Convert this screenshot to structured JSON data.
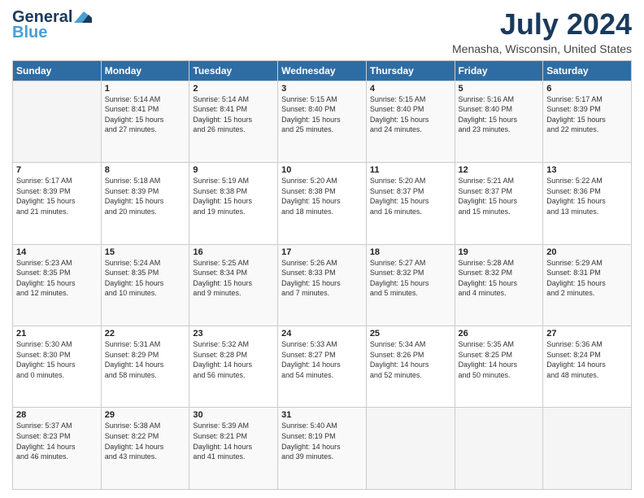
{
  "logo": {
    "line1": "General",
    "line2": "Blue"
  },
  "title": "July 2024",
  "location": "Menasha, Wisconsin, United States",
  "days_of_week": [
    "Sunday",
    "Monday",
    "Tuesday",
    "Wednesday",
    "Thursday",
    "Friday",
    "Saturday"
  ],
  "weeks": [
    [
      {
        "num": "",
        "info": ""
      },
      {
        "num": "1",
        "info": "Sunrise: 5:14 AM\nSunset: 8:41 PM\nDaylight: 15 hours\nand 27 minutes."
      },
      {
        "num": "2",
        "info": "Sunrise: 5:14 AM\nSunset: 8:41 PM\nDaylight: 15 hours\nand 26 minutes."
      },
      {
        "num": "3",
        "info": "Sunrise: 5:15 AM\nSunset: 8:40 PM\nDaylight: 15 hours\nand 25 minutes."
      },
      {
        "num": "4",
        "info": "Sunrise: 5:15 AM\nSunset: 8:40 PM\nDaylight: 15 hours\nand 24 minutes."
      },
      {
        "num": "5",
        "info": "Sunrise: 5:16 AM\nSunset: 8:40 PM\nDaylight: 15 hours\nand 23 minutes."
      },
      {
        "num": "6",
        "info": "Sunrise: 5:17 AM\nSunset: 8:39 PM\nDaylight: 15 hours\nand 22 minutes."
      }
    ],
    [
      {
        "num": "7",
        "info": "Sunrise: 5:17 AM\nSunset: 8:39 PM\nDaylight: 15 hours\nand 21 minutes."
      },
      {
        "num": "8",
        "info": "Sunrise: 5:18 AM\nSunset: 8:39 PM\nDaylight: 15 hours\nand 20 minutes."
      },
      {
        "num": "9",
        "info": "Sunrise: 5:19 AM\nSunset: 8:38 PM\nDaylight: 15 hours\nand 19 minutes."
      },
      {
        "num": "10",
        "info": "Sunrise: 5:20 AM\nSunset: 8:38 PM\nDaylight: 15 hours\nand 18 minutes."
      },
      {
        "num": "11",
        "info": "Sunrise: 5:20 AM\nSunset: 8:37 PM\nDaylight: 15 hours\nand 16 minutes."
      },
      {
        "num": "12",
        "info": "Sunrise: 5:21 AM\nSunset: 8:37 PM\nDaylight: 15 hours\nand 15 minutes."
      },
      {
        "num": "13",
        "info": "Sunrise: 5:22 AM\nSunset: 8:36 PM\nDaylight: 15 hours\nand 13 minutes."
      }
    ],
    [
      {
        "num": "14",
        "info": "Sunrise: 5:23 AM\nSunset: 8:35 PM\nDaylight: 15 hours\nand 12 minutes."
      },
      {
        "num": "15",
        "info": "Sunrise: 5:24 AM\nSunset: 8:35 PM\nDaylight: 15 hours\nand 10 minutes."
      },
      {
        "num": "16",
        "info": "Sunrise: 5:25 AM\nSunset: 8:34 PM\nDaylight: 15 hours\nand 9 minutes."
      },
      {
        "num": "17",
        "info": "Sunrise: 5:26 AM\nSunset: 8:33 PM\nDaylight: 15 hours\nand 7 minutes."
      },
      {
        "num": "18",
        "info": "Sunrise: 5:27 AM\nSunset: 8:32 PM\nDaylight: 15 hours\nand 5 minutes."
      },
      {
        "num": "19",
        "info": "Sunrise: 5:28 AM\nSunset: 8:32 PM\nDaylight: 15 hours\nand 4 minutes."
      },
      {
        "num": "20",
        "info": "Sunrise: 5:29 AM\nSunset: 8:31 PM\nDaylight: 15 hours\nand 2 minutes."
      }
    ],
    [
      {
        "num": "21",
        "info": "Sunrise: 5:30 AM\nSunset: 8:30 PM\nDaylight: 15 hours\nand 0 minutes."
      },
      {
        "num": "22",
        "info": "Sunrise: 5:31 AM\nSunset: 8:29 PM\nDaylight: 14 hours\nand 58 minutes."
      },
      {
        "num": "23",
        "info": "Sunrise: 5:32 AM\nSunset: 8:28 PM\nDaylight: 14 hours\nand 56 minutes."
      },
      {
        "num": "24",
        "info": "Sunrise: 5:33 AM\nSunset: 8:27 PM\nDaylight: 14 hours\nand 54 minutes."
      },
      {
        "num": "25",
        "info": "Sunrise: 5:34 AM\nSunset: 8:26 PM\nDaylight: 14 hours\nand 52 minutes."
      },
      {
        "num": "26",
        "info": "Sunrise: 5:35 AM\nSunset: 8:25 PM\nDaylight: 14 hours\nand 50 minutes."
      },
      {
        "num": "27",
        "info": "Sunrise: 5:36 AM\nSunset: 8:24 PM\nDaylight: 14 hours\nand 48 minutes."
      }
    ],
    [
      {
        "num": "28",
        "info": "Sunrise: 5:37 AM\nSunset: 8:23 PM\nDaylight: 14 hours\nand 46 minutes."
      },
      {
        "num": "29",
        "info": "Sunrise: 5:38 AM\nSunset: 8:22 PM\nDaylight: 14 hours\nand 43 minutes."
      },
      {
        "num": "30",
        "info": "Sunrise: 5:39 AM\nSunset: 8:21 PM\nDaylight: 14 hours\nand 41 minutes."
      },
      {
        "num": "31",
        "info": "Sunrise: 5:40 AM\nSunset: 8:19 PM\nDaylight: 14 hours\nand 39 minutes."
      },
      {
        "num": "",
        "info": ""
      },
      {
        "num": "",
        "info": ""
      },
      {
        "num": "",
        "info": ""
      }
    ]
  ]
}
